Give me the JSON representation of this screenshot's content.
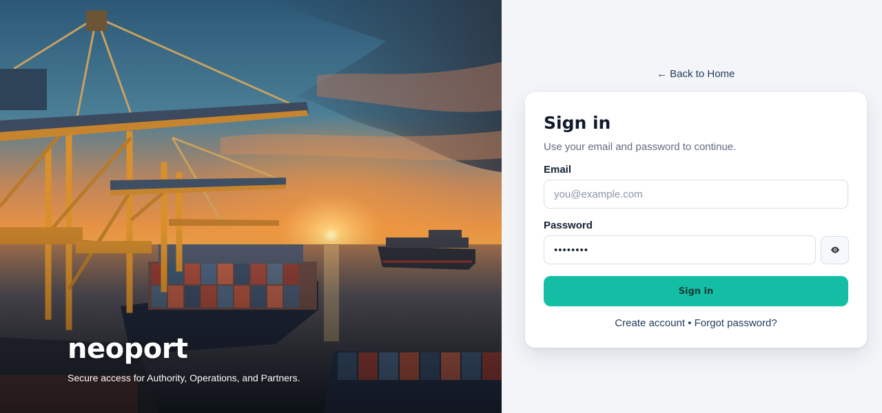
{
  "hero": {
    "brand_name": "neoport",
    "tagline": "Secure access for Authority, Operations, and Partners.",
    "image": "port-cranes-sunset-container-ship"
  },
  "panel": {
    "back_link": "← Back to Home"
  },
  "signin": {
    "title": "Sign in",
    "subtitle": "Use your email and password to continue.",
    "email_label": "Email",
    "email_placeholder": "you@example.com",
    "email_value": "",
    "password_label": "Password",
    "password_value": "••••••••",
    "toggle_icon": "eye-icon",
    "submit_label": "Sign in",
    "create_account": "Create account",
    "separator": "•",
    "forgot_password": "Forgot password?"
  },
  "colors": {
    "accent": "#14bea4",
    "panel_bg": "#f3f5f9",
    "link": "#1f3a5c",
    "title": "#0f1a2b"
  }
}
